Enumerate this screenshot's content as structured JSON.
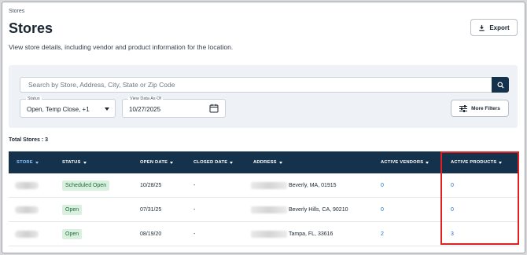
{
  "breadcrumb": "Stores",
  "page_title": "Stores",
  "subtitle": "View store details, including vendor and product information for the location.",
  "export_label": "Export",
  "search": {
    "placeholder": "Search by Store, Address, City, State or Zip Code"
  },
  "status_filter": {
    "label": "Status",
    "value": "Open, Temp Close, +1"
  },
  "date_filter": {
    "label": "View Data As Of",
    "value": "10/27/2025"
  },
  "more_filters_label": "More Filters",
  "total_stores": "Total Stores : 3",
  "columns": {
    "store": "STORE",
    "status": "STATUS",
    "open_date": "OPEN DATE",
    "closed_date": "CLOSED DATE",
    "address": "ADDRESS",
    "active_vendors": "ACTIVE VENDORS",
    "active_products": "ACTIVE PRODUCTS"
  },
  "rows": [
    {
      "status": "Scheduled Open",
      "open_date": "10/28/25",
      "closed_date": "-",
      "address": "Beverly, MA, 01915",
      "active_vendors": "0",
      "active_products": "0"
    },
    {
      "status": "Open",
      "open_date": "07/31/25",
      "closed_date": "-",
      "address": "Beverly Hills, CA, 90210",
      "active_vendors": "0",
      "active_products": "0"
    },
    {
      "status": "Open",
      "open_date": "08/19/20",
      "closed_date": "-",
      "address": "Tampa, FL, 33616",
      "active_vendors": "2",
      "active_products": "3"
    }
  ],
  "colors": {
    "header_bg": "#15324d",
    "link": "#1a6fd1",
    "badge_bg": "#d9f0df",
    "badge_text": "#1e6b3a",
    "highlight": "#e02020"
  }
}
